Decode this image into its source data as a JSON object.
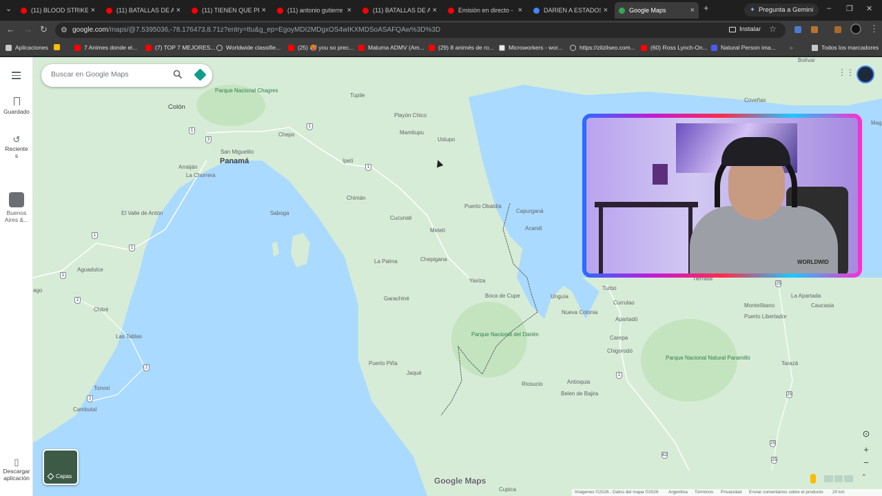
{
  "browser": {
    "tabs": [
      {
        "title": "(11) BLOOD STRIKE: A",
        "active": false
      },
      {
        "title": "(11) BATALLAS DE AU",
        "active": false
      },
      {
        "title": "(11) TIENEN QUE PR",
        "active": false
      },
      {
        "title": "(11) antonio gutierre",
        "active": false
      },
      {
        "title": "(11) BATALLAS DE AU",
        "active": false
      },
      {
        "title": "Emisión en directo -",
        "active": false
      },
      {
        "title": "DARIEN A ESTADOS",
        "active": false
      },
      {
        "title": "Google Maps",
        "active": true
      }
    ],
    "gemini_label": "Pregunta a Gemini",
    "url_host": "google.com",
    "url_path": "/maps/@7.5395036,-78.176473,8.71z?entry=ttu&g_ep=EgoyMDI2MDgxOS4wIKXMDSoASAFQAw%3D%3D",
    "install_label": "Instalar",
    "bookmarks": [
      {
        "label": "Aplicaciones",
        "icon": "grid-icon"
      },
      {
        "label": "7 Animes donde el...",
        "icon": "youtube-icon"
      },
      {
        "label": "(7) TOP 7 MEJORES...",
        "icon": "youtube-icon"
      },
      {
        "label": "Worldwide classifie...",
        "icon": "globe-icon"
      },
      {
        "label": "(25) 🥵 you so prec...",
        "icon": "youtube-icon"
      },
      {
        "label": "Maluma ADMV (Am...",
        "icon": "youtube-icon"
      },
      {
        "label": "(29) 8 animés de ro...",
        "icon": "youtube-icon"
      },
      {
        "label": "Microworkers - wor...",
        "icon": "microworkers-icon"
      },
      {
        "label": "https://zilzilseo.com...",
        "icon": "globe-icon"
      },
      {
        "label": "(60) Ross Lynch-On...",
        "icon": "youtube-icon"
      },
      {
        "label": "Natural Person ima...",
        "icon": "app-icon"
      }
    ],
    "all_bookmarks": "Todos los marcadores"
  },
  "maps": {
    "search_placeholder": "Buscar en Google Maps",
    "rail": {
      "saved": "Guardado",
      "recent": "Reciente s",
      "recent_place": "Buenos Aires &...",
      "download": "Descargar aplicación"
    },
    "places": {
      "colon": "Colón",
      "parque_chagres": "Parque Nacional Chagres",
      "tupile": "Tupile",
      "playon_chico": "Playón Chico",
      "mamitupu": "Mamitupu",
      "ustupo": "Ustupo",
      "chepo": "Chepo",
      "san_miguelito": "San Miguelito",
      "panama": "Panamá",
      "arraijan": "Arraiján",
      "la_chorrera": "La Chorrera",
      "ipeti": "Ipetí",
      "chiman": "Chimán",
      "saboga": "Saboga",
      "el_valle": "El Valle de Antón",
      "cucunati": "Cucunati",
      "meteti": "Metetí",
      "puerto_obaldia": "Puerto Obaldía",
      "capurgana": "Capurganá",
      "acandi": "Acandí",
      "la_palma": "La Palma",
      "chepigana": "Chepigana",
      "yaviza": "Yaviza",
      "aguadulce": "Aguadulce",
      "garachine": "Garachiné",
      "boca_de_cupe": "Boca de Cupe",
      "unguia": "Unguía",
      "nueva_colonia": "Nueva Colonia",
      "turbo": "Turbo",
      "currulao": "Currulao",
      "apartado": "Apartadó",
      "carepa": "Carepa",
      "chigorodo": "Chigorodó",
      "parque_darien": "Parque Nacional del Darién",
      "chitre": "Chitré",
      "las_tablas": "Las Tablas",
      "puerto_pina": "Puerto Piña",
      "jaque": "Jaqué",
      "riosucio": "Riosucio",
      "antioquia": "Antioquia",
      "belen_de_bajira": "Belen de Bajira",
      "tonosi": "Tonosí",
      "cambutal": "Cambutal",
      "ago": "ago",
      "covenas": "Coveñas",
      "mag": "Mag",
      "tierralta": "Tierralta",
      "la_apartada": "La Apartada",
      "caucasia": "Caucasia",
      "montelibano": "Montelíbano",
      "puerto_libertador": "Puerto Libertador",
      "parque_paramillo": "Parque Nacional Natural Paramillo",
      "taraza": "Tarazá",
      "cupica": "Cupica",
      "bolivar": "Bolívar"
    },
    "route_shields": [
      "1",
      "1",
      "1",
      "1",
      "1",
      "1",
      "2",
      "2",
      "2",
      "3",
      "2",
      "25",
      "25",
      "25",
      "62",
      "25"
    ],
    "layers_label": "Capas",
    "brand": "Google Maps",
    "footer": {
      "imagery": "Imágenes ©2026 , Datos del mapa ©2026",
      "country": "Argentina",
      "terms": "Términos",
      "privacy": "Privacidad",
      "feedback": "Enviar comentarios sobre el producto",
      "scale": "20 km"
    },
    "colors": {
      "water": "#aadaff",
      "land": "#d7ecd6",
      "park": "#c4e4c0",
      "border": "#5f6368"
    }
  },
  "webcam": {
    "shirt_text": "WORLDWID"
  }
}
